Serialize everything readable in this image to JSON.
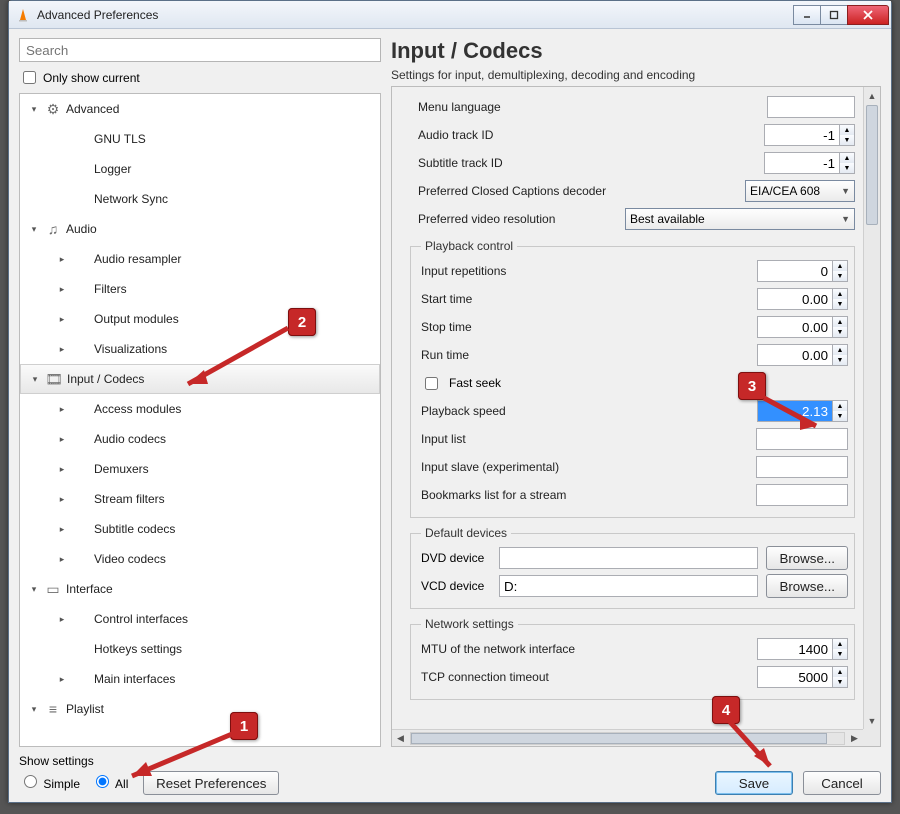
{
  "window": {
    "title": "Advanced Preferences",
    "min_tip": "Minimize",
    "max_tip": "Maximize",
    "close_tip": "Close"
  },
  "left": {
    "search_placeholder": "Search",
    "only_current": "Only show current",
    "tree": [
      {
        "indent": 0,
        "arrow": "▾",
        "icon": "⚙",
        "label": "Advanced"
      },
      {
        "indent": 1,
        "arrow": "",
        "icon": "",
        "label": "GNU TLS"
      },
      {
        "indent": 1,
        "arrow": "",
        "icon": "",
        "label": "Logger"
      },
      {
        "indent": 1,
        "arrow": "",
        "icon": "",
        "label": "Network Sync"
      },
      {
        "indent": 0,
        "arrow": "▾",
        "icon": "♫",
        "label": "Audio"
      },
      {
        "indent": 1,
        "arrow": "▸",
        "icon": "",
        "label": "Audio resampler"
      },
      {
        "indent": 1,
        "arrow": "▸",
        "icon": "",
        "label": "Filters"
      },
      {
        "indent": 1,
        "arrow": "▸",
        "icon": "",
        "label": "Output modules"
      },
      {
        "indent": 1,
        "arrow": "▸",
        "icon": "",
        "label": "Visualizations"
      },
      {
        "indent": 0,
        "arrow": "▾",
        "icon": "🎞",
        "label": "Input / Codecs",
        "selected": true
      },
      {
        "indent": 1,
        "arrow": "▸",
        "icon": "",
        "label": "Access modules"
      },
      {
        "indent": 1,
        "arrow": "▸",
        "icon": "",
        "label": "Audio codecs"
      },
      {
        "indent": 1,
        "arrow": "▸",
        "icon": "",
        "label": "Demuxers"
      },
      {
        "indent": 1,
        "arrow": "▸",
        "icon": "",
        "label": "Stream filters"
      },
      {
        "indent": 1,
        "arrow": "▸",
        "icon": "",
        "label": "Subtitle codecs"
      },
      {
        "indent": 1,
        "arrow": "▸",
        "icon": "",
        "label": "Video codecs"
      },
      {
        "indent": 0,
        "arrow": "▾",
        "icon": "▭",
        "label": "Interface"
      },
      {
        "indent": 1,
        "arrow": "▸",
        "icon": "",
        "label": "Control interfaces"
      },
      {
        "indent": 1,
        "arrow": "",
        "icon": "",
        "label": "Hotkeys settings"
      },
      {
        "indent": 1,
        "arrow": "▸",
        "icon": "",
        "label": "Main interfaces"
      },
      {
        "indent": 0,
        "arrow": "▾",
        "icon": "≡",
        "label": "Playlist"
      }
    ]
  },
  "page": {
    "title": "Input / Codecs",
    "subtitle": "Settings for input, demultiplexing, decoding and encoding",
    "top": {
      "menu_language": "Menu language",
      "menu_language_val": "",
      "audio_track_id": "Audio track ID",
      "audio_track_id_val": "-1",
      "subtitle_track_id": "Subtitle track ID",
      "subtitle_track_id_val": "-1",
      "cc_decoder": "Preferred Closed Captions decoder",
      "cc_decoder_val": "EIA/CEA 608",
      "video_res": "Preferred video resolution",
      "video_res_val": "Best available"
    },
    "playback": {
      "legend": "Playback control",
      "input_rep": "Input repetitions",
      "input_rep_val": "0",
      "start_time": "Start time",
      "start_time_val": "0.00",
      "stop_time": "Stop time",
      "stop_time_val": "0.00",
      "run_time": "Run time",
      "run_time_val": "0.00",
      "fast_seek": "Fast seek",
      "playback_speed": "Playback speed",
      "playback_speed_val": "2.13",
      "input_list": "Input list",
      "input_list_val": "",
      "input_slave": "Input slave (experimental)",
      "input_slave_val": "",
      "bookmarks": "Bookmarks list for a stream",
      "bookmarks_val": ""
    },
    "devices": {
      "legend": "Default devices",
      "dvd": "DVD device",
      "dvd_val": "",
      "vcd": "VCD device",
      "vcd_val": "D:",
      "browse": "Browse..."
    },
    "network": {
      "legend": "Network settings",
      "mtu": "MTU of the network interface",
      "mtu_val": "1400",
      "tcp_timeout": "TCP connection timeout",
      "tcp_timeout_val": "5000"
    }
  },
  "bottom": {
    "show_settings": "Show settings",
    "simple": "Simple",
    "all": "All",
    "reset": "Reset Preferences",
    "save": "Save",
    "cancel": "Cancel"
  },
  "annotations": {
    "b1": "1",
    "b2": "2",
    "b3": "3",
    "b4": "4"
  }
}
